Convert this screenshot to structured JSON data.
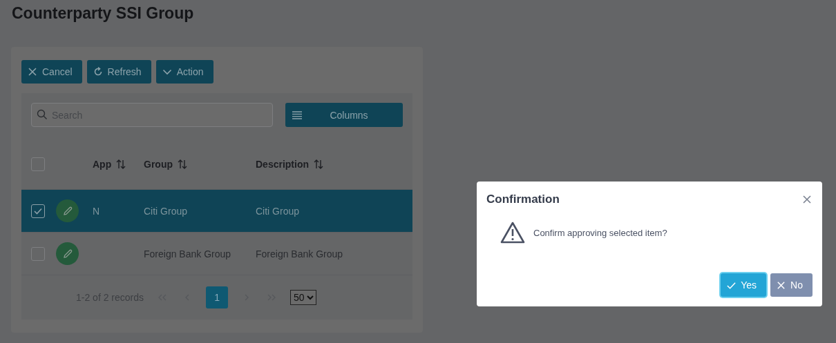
{
  "page": {
    "title": "Counterparty SSI Group"
  },
  "toolbar": [
    {
      "label": "Cancel",
      "kind": "close"
    },
    {
      "label": "Refresh",
      "kind": "refresh"
    },
    {
      "label": "Action",
      "kind": "chevron"
    }
  ],
  "search": {
    "placeholder": "Search"
  },
  "columns_button": {
    "label": "Columns"
  },
  "table": {
    "all_checked": false,
    "columns": [
      "App",
      "Group",
      "Description"
    ],
    "rows": [
      {
        "selected": true,
        "app": "N",
        "group": "Citi Group",
        "description": "Citi Group"
      },
      {
        "selected": false,
        "group": "Foreign Bank Group",
        "description": "Foreign Bank Group"
      }
    ]
  },
  "paginator": {
    "summary": "1-2 of 2 records",
    "pages": [
      {
        "label": "1",
        "selected": true
      }
    ],
    "page_size": "50"
  },
  "dialog": {
    "title": "Confirmation",
    "message": "Confirm approving selected item?",
    "buttons": [
      {
        "label": "Yes",
        "kind": "confirm"
      },
      {
        "label": "No",
        "kind": "cancel"
      }
    ]
  }
}
